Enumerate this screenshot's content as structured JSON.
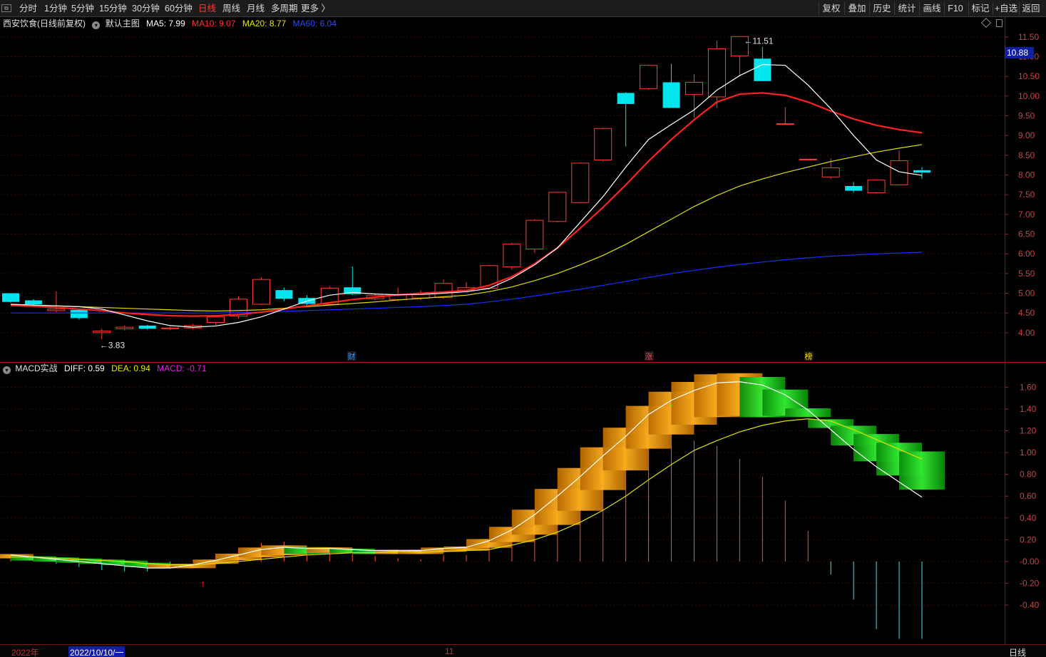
{
  "toolbar": {
    "periods": [
      {
        "label": "分时",
        "active": false
      },
      {
        "label": "1分钟",
        "active": false
      },
      {
        "label": "5分钟",
        "active": false
      },
      {
        "label": "15分钟",
        "active": false
      },
      {
        "label": "30分钟",
        "active": false
      },
      {
        "label": "60分钟",
        "active": false
      },
      {
        "label": "日线",
        "active": true
      },
      {
        "label": "周线",
        "active": false
      },
      {
        "label": "月线",
        "active": false
      },
      {
        "label": "多周期",
        "active": false
      },
      {
        "label": "更多 〉",
        "active": false
      }
    ],
    "actions": [
      "复权",
      "叠加",
      "历史",
      "统计",
      "画线",
      "F10",
      "标记",
      "+自选",
      "返回"
    ]
  },
  "price_pane": {
    "stock_name": "西安饮食(日线前复权)",
    "template": "默认主图",
    "ma5_label": "MA5: 7.99",
    "ma10_label": "MA10: 9.07",
    "ma20_label": "MA20: 8.77",
    "ma60_label": "MA60: 6.04",
    "high_label": "11.51",
    "low_label": "3.83",
    "current_price": "10.88",
    "axis_ticks": [
      "11.50",
      "11.00",
      "10.50",
      "10.00",
      "9.50",
      "9.00",
      "8.50",
      "8.00",
      "7.50",
      "7.00",
      "6.50",
      "6.00",
      "5.50",
      "5.00",
      "4.50",
      "4.00"
    ],
    "event_marks": [
      {
        "label": "财",
        "color": "#3a8cff"
      },
      {
        "label": "涨",
        "color": "#ff4040"
      },
      {
        "label": "榜",
        "color": "#ffd000"
      }
    ]
  },
  "macd_pane": {
    "title": "MACD实战",
    "diff_label": "DIFF: 0.59",
    "dea_label": "DEA: 0.94",
    "macd_label": "MACD: -0.71",
    "axis_ticks": [
      "1.60",
      "1.40",
      "1.20",
      "1.00",
      "0.80",
      "0.60",
      "0.40",
      "0.20",
      "-0.00",
      "-0.20",
      "-0.40"
    ]
  },
  "datebar": {
    "year_label": "2022年",
    "current_date": "2022/10/10/一",
    "month_label": "11",
    "period": "日线"
  },
  "colors": {
    "up": "#ff3b30",
    "down": "#00e5ee",
    "ma5": "#ffffff",
    "ma10": "#ff2020",
    "ma20": "#e0e000",
    "ma60": "#1830ff",
    "diff": "#ffffff",
    "dea": "#e0e000"
  },
  "chart_data": {
    "type": "candlestick",
    "candles": [
      {
        "o": 5.0,
        "c": 4.78,
        "h": 5.0,
        "l": 4.76
      },
      {
        "o": 4.82,
        "c": 4.72,
        "h": 4.85,
        "l": 4.68
      },
      {
        "o": 4.56,
        "c": 4.6,
        "h": 5.05,
        "l": 4.52
      },
      {
        "o": 4.58,
        "c": 4.37,
        "h": 4.6,
        "l": 4.33
      },
      {
        "o": 4.0,
        "c": 4.04,
        "h": 4.1,
        "l": 3.83
      },
      {
        "o": 4.1,
        "c": 4.14,
        "h": 4.18,
        "l": 4.06
      },
      {
        "o": 4.18,
        "c": 4.1,
        "h": 4.2,
        "l": 4.08
      },
      {
        "o": 4.1,
        "c": 4.12,
        "h": 4.15,
        "l": 4.07
      },
      {
        "o": 4.12,
        "c": 4.18,
        "h": 4.22,
        "l": 4.08
      },
      {
        "o": 4.26,
        "c": 4.4,
        "h": 4.45,
        "l": 4.2
      },
      {
        "o": 4.42,
        "c": 4.85,
        "h": 4.92,
        "l": 4.36
      },
      {
        "o": 4.72,
        "c": 5.35,
        "h": 5.4,
        "l": 4.7
      },
      {
        "o": 5.08,
        "c": 4.86,
        "h": 5.14,
        "l": 4.8
      },
      {
        "o": 4.88,
        "c": 4.73,
        "h": 4.95,
        "l": 4.68
      },
      {
        "o": 4.72,
        "c": 5.13,
        "h": 5.18,
        "l": 4.7
      },
      {
        "o": 5.15,
        "c": 4.98,
        "h": 5.68,
        "l": 4.95
      },
      {
        "o": 4.86,
        "c": 4.94,
        "h": 5.0,
        "l": 4.82
      },
      {
        "o": 4.84,
        "c": 4.96,
        "h": 5.15,
        "l": 4.8
      },
      {
        "o": 4.88,
        "c": 4.98,
        "h": 5.08,
        "l": 4.82
      },
      {
        "o": 4.89,
        "c": 5.25,
        "h": 5.35,
        "l": 4.86
      },
      {
        "o": 5.08,
        "c": 5.14,
        "h": 5.28,
        "l": 5.02
      },
      {
        "o": 5.13,
        "c": 5.7,
        "h": 5.72,
        "l": 5.1
      },
      {
        "o": 5.67,
        "c": 6.25,
        "h": 6.28,
        "l": 5.6
      },
      {
        "o": 6.12,
        "c": 6.85,
        "h": 6.88,
        "l": 6.02
      },
      {
        "o": 6.82,
        "c": 7.56,
        "h": 7.58,
        "l": 6.8
      },
      {
        "o": 7.3,
        "c": 8.3,
        "h": 8.32,
        "l": 7.28
      },
      {
        "o": 8.38,
        "c": 9.18,
        "h": 9.2,
        "l": 8.34
      },
      {
        "o": 10.08,
        "c": 9.8,
        "h": 10.1,
        "l": 8.72
      },
      {
        "o": 10.19,
        "c": 10.78,
        "h": 10.8,
        "l": 10.16
      },
      {
        "o": 10.35,
        "c": 9.7,
        "h": 10.82,
        "l": 9.7
      },
      {
        "o": 10.04,
        "c": 10.35,
        "h": 10.56,
        "l": 9.45
      },
      {
        "o": 9.98,
        "c": 11.2,
        "h": 11.4,
        "l": 9.7
      },
      {
        "o": 11.02,
        "c": 11.51,
        "h": 11.51,
        "l": 10.5
      },
      {
        "o": 10.95,
        "c": 10.38,
        "h": 11.25,
        "l": 10.38
      },
      {
        "o": 9.3,
        "c": 9.3,
        "h": 9.72,
        "l": 9.3
      },
      {
        "o": 8.4,
        "c": 8.4,
        "h": 8.4,
        "l": 8.4
      },
      {
        "o": 7.95,
        "c": 8.18,
        "h": 8.42,
        "l": 7.9
      },
      {
        "o": 7.72,
        "c": 7.6,
        "h": 7.82,
        "l": 7.55
      },
      {
        "o": 7.55,
        "c": 7.87,
        "h": 7.88,
        "l": 7.53
      },
      {
        "o": 7.75,
        "c": 8.36,
        "h": 8.62,
        "l": 7.75
      },
      {
        "o": 8.12,
        "c": 8.06,
        "h": 8.2,
        "l": 7.9
      }
    ],
    "ma5": [
      4.72,
      4.7,
      4.68,
      4.66,
      4.6,
      4.45,
      4.3,
      4.18,
      4.14,
      4.17,
      4.26,
      4.4,
      4.6,
      4.8,
      4.95,
      5.02,
      4.98,
      4.96,
      4.97,
      5.0,
      5.04,
      5.12,
      5.38,
      5.72,
      6.15,
      6.8,
      7.45,
      8.2,
      8.9,
      9.28,
      9.65,
      10.15,
      10.52,
      10.8,
      10.78,
      10.28,
      9.68,
      9.0,
      8.38,
      8.08,
      7.99
    ],
    "ma10": [
      4.69,
      4.67,
      4.64,
      4.6,
      4.56,
      4.5,
      4.46,
      4.43,
      4.42,
      4.43,
      4.46,
      4.52,
      4.6,
      4.68,
      4.76,
      4.84,
      4.9,
      4.96,
      5.0,
      5.03,
      5.07,
      5.2,
      5.42,
      5.75,
      6.15,
      6.65,
      7.18,
      7.75,
      8.35,
      8.9,
      9.4,
      9.85,
      10.05,
      10.08,
      10.02,
      9.85,
      9.62,
      9.42,
      9.26,
      9.15,
      9.07
    ],
    "ma20": [
      4.7,
      4.69,
      4.68,
      4.66,
      4.64,
      4.62,
      4.6,
      4.58,
      4.56,
      4.55,
      4.56,
      4.58,
      4.62,
      4.66,
      4.7,
      4.74,
      4.78,
      4.83,
      4.87,
      4.91,
      4.95,
      5.04,
      5.16,
      5.32,
      5.5,
      5.72,
      5.96,
      6.24,
      6.56,
      6.88,
      7.2,
      7.48,
      7.72,
      7.9,
      8.06,
      8.2,
      8.34,
      8.46,
      8.58,
      8.68,
      8.77
    ],
    "ma60": [
      4.5,
      4.5,
      4.5,
      4.5,
      4.5,
      4.5,
      4.5,
      4.5,
      4.5,
      4.5,
      4.51,
      4.52,
      4.54,
      4.56,
      4.58,
      4.6,
      4.62,
      4.64,
      4.66,
      4.69,
      4.72,
      4.78,
      4.85,
      4.93,
      5.02,
      5.1,
      5.2,
      5.3,
      5.4,
      5.5,
      5.58,
      5.66,
      5.73,
      5.79,
      5.85,
      5.9,
      5.94,
      5.97,
      6.0,
      6.02,
      6.04
    ],
    "diff": [
      0.06,
      0.04,
      0.02,
      0.0,
      -0.02,
      -0.04,
      -0.06,
      -0.06,
      -0.03,
      0.01,
      0.06,
      0.11,
      0.13,
      0.12,
      0.12,
      0.11,
      0.1,
      0.1,
      0.1,
      0.12,
      0.13,
      0.19,
      0.29,
      0.43,
      0.6,
      0.78,
      0.97,
      1.15,
      1.35,
      1.48,
      1.57,
      1.64,
      1.65,
      1.62,
      1.53,
      1.39,
      1.21,
      1.03,
      0.87,
      0.73,
      0.59
    ],
    "dea": [
      0.04,
      0.04,
      0.03,
      0.02,
      0.01,
      0.0,
      -0.02,
      -0.03,
      -0.03,
      -0.02,
      0.0,
      0.02,
      0.04,
      0.06,
      0.07,
      0.08,
      0.08,
      0.09,
      0.09,
      0.09,
      0.1,
      0.11,
      0.15,
      0.2,
      0.27,
      0.36,
      0.47,
      0.6,
      0.75,
      0.89,
      1.02,
      1.11,
      1.19,
      1.25,
      1.29,
      1.31,
      1.29,
      1.21,
      1.12,
      1.03,
      0.94
    ],
    "macd": [
      0.05,
      0.02,
      -0.02,
      -0.05,
      -0.08,
      -0.09,
      -0.09,
      -0.06,
      0.01,
      0.07,
      0.12,
      0.17,
      0.18,
      0.13,
      0.11,
      0.07,
      0.05,
      0.03,
      0.02,
      0.06,
      0.06,
      0.16,
      0.28,
      0.46,
      0.66,
      0.84,
      1.0,
      1.14,
      1.19,
      1.17,
      1.11,
      1.06,
      0.94,
      0.78,
      0.56,
      0.28,
      -0.12,
      -0.35,
      -0.62,
      -0.71,
      -0.71
    ],
    "price_ylim": [
      3.6,
      11.75
    ],
    "macd_ylim": [
      -0.72,
      1.74
    ]
  }
}
